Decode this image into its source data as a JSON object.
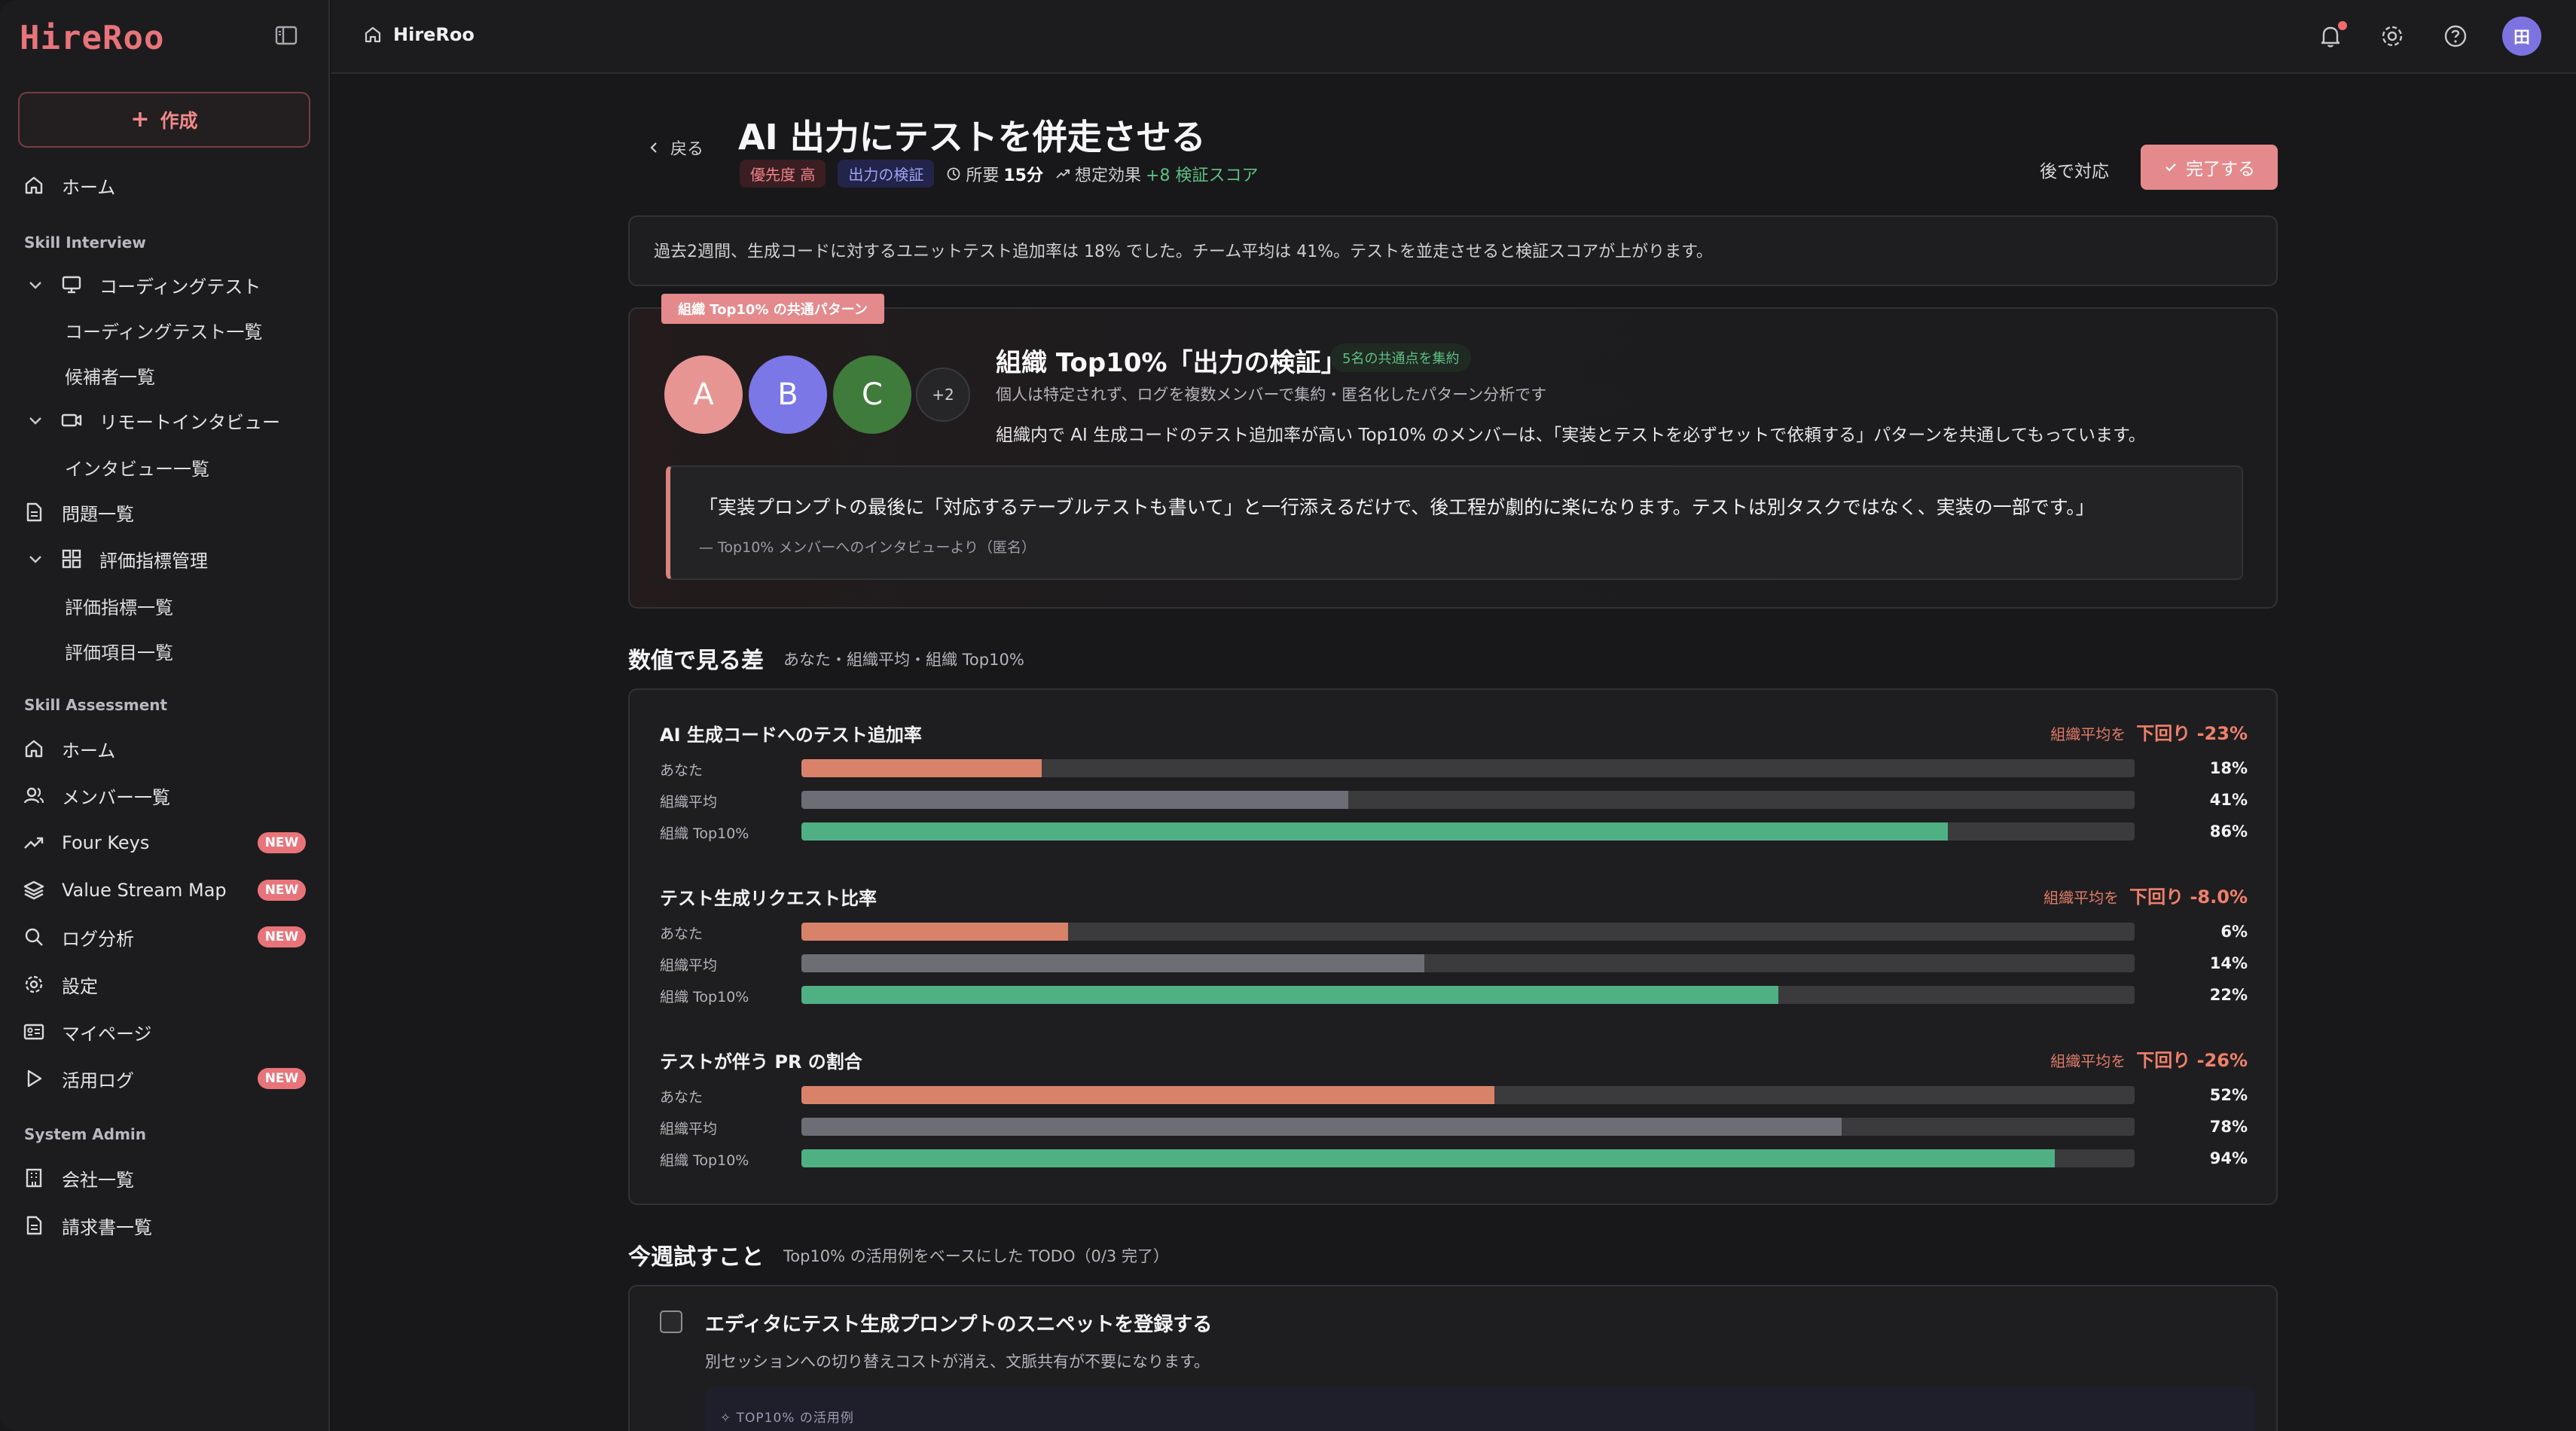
{
  "brand": {
    "logo_text": "HireRoo",
    "accent": "#e8747a"
  },
  "sidebar": {
    "create_label": "作成",
    "items": {
      "home1": "ホーム",
      "skill_interview": "Skill Interview",
      "coding_test": "コーディングテスト",
      "coding_test_list": "コーディングテスト一覧",
      "candidates": "候補者一覧",
      "remote_interview": "リモートインタビュー",
      "interview_list": "インタビュー一覧",
      "problems": "問題一覧",
      "eval_mgmt": "評価指標管理",
      "eval_list": "評価指標一覧",
      "eval_items": "評価項目一覧",
      "skill_assessment": "Skill Assessment",
      "home2": "ホーム",
      "members": "メンバー一覧",
      "four_keys": "Four Keys",
      "value_stream": "Value Stream Map",
      "log_analysis": "ログ分析",
      "settings": "設定",
      "mypage": "マイページ",
      "usage_log": "活用ログ",
      "system_admin": "System Admin",
      "companies": "会社一覧",
      "invoices": "請求書一覧"
    },
    "new_badge": "NEW"
  },
  "topbar": {
    "breadcrumb": "HireRoo",
    "avatar_initial": "田"
  },
  "header": {
    "back_label": "戻る",
    "title": "AI 出力にテストを併走させる",
    "tag_priority": "優先度 高",
    "tag_category": "出力の検証",
    "time_label": "所要",
    "time_value": "15分",
    "effect_label": "想定効果",
    "effect_value": "+8 検証スコア",
    "later_label": "後で対応",
    "done_label": "完了する"
  },
  "info": "過去2週間、生成コードに対するユニットテスト追加率は 18% でした。チーム平均は 41%。テストを並走させると検証スコアが上がります。",
  "pattern": {
    "label": "組織 Top10% の共通パターン",
    "avatars": [
      "A",
      "B",
      "C"
    ],
    "more": "+2",
    "title": "組織 Top10%「出力の検証」",
    "chip": "5名の共通点を集約",
    "sub": "個人は特定されず、ログを複数メンバーで集約・匿名化したパターン分析です",
    "desc": "組織内で AI 生成コードのテスト追加率が高い Top10% のメンバーは、「実装とテストを必ずセットで依頼する」パターンを共通してもっています。",
    "quote": "「実装プロンプトの最後に「対応するテーブルテストも書いて」と一行添えるだけで、後工程が劇的に楽になります。テストは別タスクではなく、実装の一部です。」",
    "quote_src": "— Top10% メンバーへのインタビューより（匿名）"
  },
  "metrics_section": {
    "title": "数値で見る差",
    "sub": "あなた・組織平均・組織 Top10%"
  },
  "metrics": [
    {
      "name": "AI 生成コードへのテスト追加率",
      "cmp_label": "組織平均を",
      "cmp_value": "下回り -23%",
      "rows": [
        {
          "label": "あなた",
          "value": "18%",
          "pct": 18
        },
        {
          "label": "組織平均",
          "value": "41%",
          "pct": 41
        },
        {
          "label": "組織 Top10%",
          "value": "86%",
          "pct": 86
        }
      ]
    },
    {
      "name": "テスト生成リクエスト比率",
      "cmp_label": "組織平均を",
      "cmp_value": "下回り -8.0%",
      "rows": [
        {
          "label": "あなた",
          "value": "6%",
          "pct": 20
        },
        {
          "label": "組織平均",
          "value": "14%",
          "pct": 46.7
        },
        {
          "label": "組織 Top10%",
          "value": "22%",
          "pct": 73.3
        }
      ]
    },
    {
      "name": "テストが伴う PR の割合",
      "cmp_label": "組織平均を",
      "cmp_value": "下回り -26%",
      "rows": [
        {
          "label": "あなた",
          "value": "52%",
          "pct": 52
        },
        {
          "label": "組織平均",
          "value": "78%",
          "pct": 78
        },
        {
          "label": "組織 Top10%",
          "value": "94%",
          "pct": 94
        }
      ]
    }
  ],
  "colors": {
    "you": "#d9826a",
    "avg": "#6d6e75",
    "top": "#4fb084"
  },
  "todo_section": {
    "title": "今週試すこと",
    "sub": "Top10% の活用例をベースにした TODO（0/3 完了）"
  },
  "todo": {
    "title": "エディタにテスト生成プロンプトのスニペットを登録する",
    "desc": "別セッションへの切り替えコストが消え、文脈共有が不要になります。",
    "example_label": "TOP10% の活用例"
  }
}
